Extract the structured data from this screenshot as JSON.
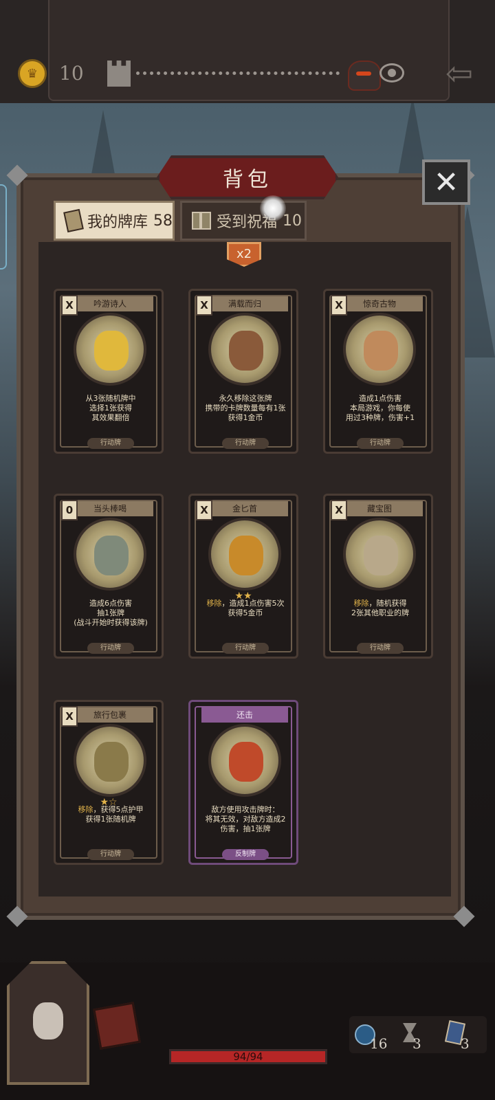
{
  "topbar": {
    "coin_icon": "crown-coin-icon",
    "coins": "10",
    "map_start_icon": "castle-icon",
    "boss_icon": "boss-icon",
    "vision_icon": "eye-icon",
    "back_icon": "back-arrow-icon",
    "back_glyph": "⇦"
  },
  "panel": {
    "title": "背包",
    "close_glyph": "✕",
    "badge": "x2",
    "tabs": [
      {
        "label": "我的牌库",
        "count": "58",
        "icon": "deck-icon"
      },
      {
        "label": "受到祝福",
        "count": "10",
        "icon": "gift-icon"
      }
    ]
  },
  "cards": [
    {
      "name": "吟游诗人",
      "cost": "X",
      "art_color": "#e0b83c",
      "desc_pre": "",
      "desc": "从3张随机牌中\n选择1张获得\n其效果翻倍",
      "stars": "",
      "type": "行动牌",
      "variant": "normal"
    },
    {
      "name": "满载而归",
      "cost": "X",
      "art_color": "#8a5a3a",
      "desc_pre": "",
      "desc": "永久移除这张牌\n携带的卡牌数量每有1张\n获得1金币",
      "stars": "",
      "type": "行动牌",
      "variant": "normal"
    },
    {
      "name": "惊奇古物",
      "cost": "X",
      "art_color": "#c08a5c",
      "desc_pre": "",
      "desc": "造成1点伤害\n本局游戏，你每使\n用过3种牌，伤害+1",
      "stars": "",
      "type": "行动牌",
      "variant": "normal"
    },
    {
      "name": "当头棒喝",
      "cost": "0",
      "art_color": "#7f8a7a",
      "desc_pre": "",
      "desc": "造成6点伤害\n抽1张牌\n(战斗开始时获得该牌)",
      "stars": "",
      "type": "行动牌",
      "variant": "normal"
    },
    {
      "name": "金匕首",
      "cost": "X",
      "art_color": "#c88a2a",
      "desc_pre": "移除",
      "desc": "，造成1点伤害5次\n获得5金币",
      "stars": "★★",
      "type": "行动牌",
      "variant": "normal"
    },
    {
      "name": "藏宝图",
      "cost": "X",
      "art_color": "#b8a88a",
      "desc_pre": "移除",
      "desc": "，随机获得\n2张其他职业的牌",
      "stars": "",
      "type": "行动牌",
      "variant": "normal"
    },
    {
      "name": "旅行包裹",
      "cost": "X",
      "art_color": "#8a7a4a",
      "desc_pre": "移除",
      "desc": "，获得5点护甲\n获得1张随机牌",
      "stars": "★☆",
      "type": "行动牌",
      "variant": "normal"
    },
    {
      "name": "还击",
      "cost": "",
      "art_color": "#c04a2a",
      "desc_pre": "",
      "desc": "敌方使用攻击牌时：\n将其无效，对敌方造成2\n伤害，抽1张牌",
      "stars": "",
      "type": "反制牌",
      "variant": "purple"
    }
  ],
  "hud": {
    "hp": "94/94",
    "orbs": "16",
    "turns": "3",
    "hand": "3"
  }
}
